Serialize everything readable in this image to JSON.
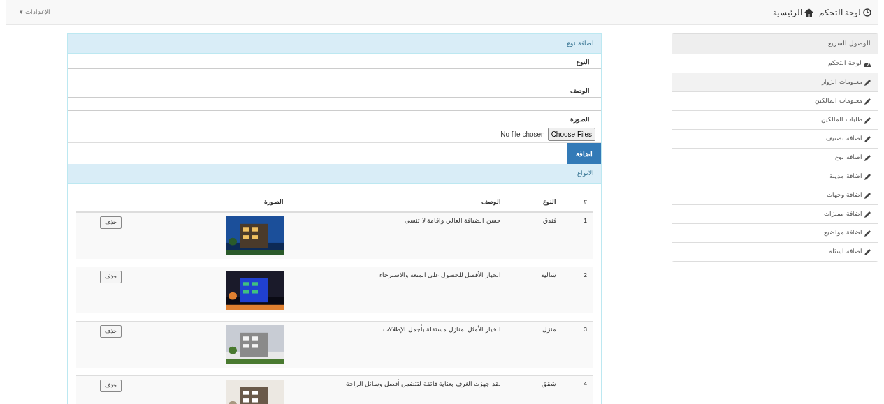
{
  "navbar": {
    "links": [
      {
        "kind": "clock",
        "label": "لوحة التحكم"
      },
      {
        "kind": "home",
        "label": "الرئيسية"
      }
    ],
    "settings": "الإعدادات",
    "caret": "▾"
  },
  "sidebar": {
    "title": "الوصول السريع",
    "items": [
      {
        "kind": "dashboard",
        "label": "لوحة التحكم",
        "selected": false
      },
      {
        "kind": "pencil",
        "label": "معلومات الزوار",
        "selected": true
      },
      {
        "kind": "pencil",
        "label": "معلومات المالكين",
        "selected": false
      },
      {
        "kind": "pencil",
        "label": "طلبات المالكين",
        "selected": false
      },
      {
        "kind": "pencil",
        "label": "اضافة تصنيف",
        "selected": false
      },
      {
        "kind": "pencil",
        "label": "اضافة نوع",
        "selected": false
      },
      {
        "kind": "pencil",
        "label": "اضافة مدينة",
        "selected": false
      },
      {
        "kind": "pencil",
        "label": "اضافة وجهات",
        "selected": false
      },
      {
        "kind": "pencil",
        "label": "اضافة مميزات",
        "selected": false
      },
      {
        "kind": "pencil",
        "label": "اضافة مواضيع",
        "selected": false
      },
      {
        "kind": "pencil",
        "label": "اضافة اسئلة",
        "selected": false
      }
    ]
  },
  "form": {
    "title": "اضافة نوع",
    "fields": [
      {
        "kind": "text",
        "label": "النوع"
      },
      {
        "kind": "text",
        "label": "الوصف"
      },
      {
        "kind": "file",
        "label": "الصورة",
        "button": "Choose Files",
        "status": "No file chosen"
      }
    ],
    "submit": "اضافة"
  },
  "table": {
    "title": "الانواع",
    "columns": [
      "#",
      "النوع",
      "الوصف",
      "الصورة"
    ],
    "rows": [
      {
        "number": "1",
        "type": "فندق",
        "description": "حسن الضيافة العالي واقامة لا تنسى",
        "action": "حذف"
      },
      {
        "number": "2",
        "type": "شاليه",
        "description": "الخيار الأفضل للحصول على المتعة والاسترخاء",
        "action": "حذف"
      },
      {
        "number": "3",
        "type": "منزل",
        "description": "الخيار الأمثل لمنازل مستقلة بأجمل الإطلالات",
        "action": "حذف"
      },
      {
        "number": "4",
        "type": "شقق",
        "description": "لقد جهزت الغرف بعناية فائقة لتتضمن أفضل وسائل الراحة",
        "action": "حذف"
      }
    ]
  }
}
